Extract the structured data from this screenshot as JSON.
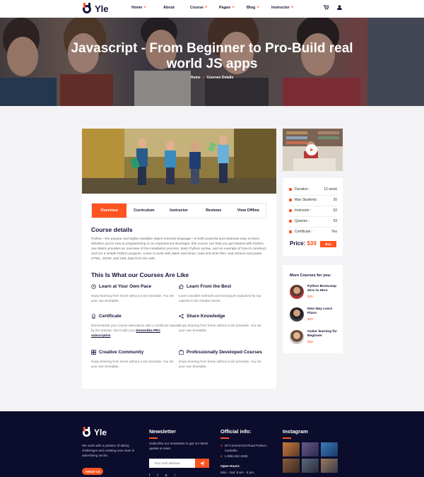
{
  "brand": {
    "name": "Yle",
    "accent": "#ff5421",
    "dark": "#15153a"
  },
  "nav": {
    "items": [
      {
        "label": "Home",
        "plus": "+"
      },
      {
        "label": "About",
        "plus": ""
      },
      {
        "label": "Course",
        "plus": "+"
      },
      {
        "label": "Pages",
        "plus": "+"
      },
      {
        "label": "Blog",
        "plus": "+"
      },
      {
        "label": "Instructor",
        "plus": "+"
      }
    ],
    "icons": [
      "cart-icon",
      "user-icon"
    ]
  },
  "hero": {
    "title": "Javascript - From Beginner to Pro-Build real world JS apps",
    "breadcrumb": {
      "home": "Home",
      "sep": "»",
      "current": "Courses Details"
    }
  },
  "tabs": [
    {
      "label": "Overview",
      "active": true
    },
    {
      "label": "Curriculum",
      "active": false
    },
    {
      "label": "Instructor",
      "active": false
    },
    {
      "label": "Reviews",
      "active": false
    },
    {
      "label": "View Offline",
      "active": false
    }
  ],
  "details": {
    "title": "Course details",
    "text": "Python—the popular and highly readable object-oriented language—is both powerful and relatively easy to learn. Whether you're new to programming or an experienced developer, this course can help you get started with Python. Joe Marini provides an overview of the installation process, basic Python syntax, and an example of how to construct and run a simple Python program. Learn to work with dates and times, read and write files, and retrieve and parse HTML, JSON, and XML data from the web."
  },
  "features": {
    "title": "This Is What our Courses Are Like",
    "items": [
      {
        "icon": "clock-icon",
        "title": "Learn at Your Own Pace",
        "text": "Enjoy learning from home without a set schedule. You set your own timetable.",
        "link": ""
      },
      {
        "icon": "thumbs-up-icon",
        "title": "Learn From the Best",
        "text": "Learn valuable methods and techniques explained by top experts in the creative sector.",
        "link": ""
      },
      {
        "icon": "certificate-icon",
        "title": "Certificate",
        "text": "Demonstrate your course attendance with a certificate signed by the teacher. Get it with your",
        "link": "Domestika PRO subscription"
      },
      {
        "icon": "share-icon",
        "title": "Share Knowledge",
        "text": "Enjoy learning from home without a set schedule. You set your own timetable.",
        "link": ""
      },
      {
        "icon": "community-icon",
        "title": "Creative Community",
        "text": "Enjoy learning from home without a set schedule. You set your own timetable.",
        "link": ""
      },
      {
        "icon": "briefcase-icon",
        "title": "Professionally Developed Courses",
        "text": "Enjoy learning from home without a set schedule. You set your own timetable.",
        "link": ""
      }
    ]
  },
  "info": {
    "rows": [
      {
        "label": "Duration :",
        "value": "12 week"
      },
      {
        "label": "Max Students :",
        "value": "20"
      },
      {
        "label": "Instructor :",
        "value": "02"
      },
      {
        "label": "Quizzes :",
        "value": "03"
      },
      {
        "label": "Certificate :",
        "value": "Yes"
      }
    ],
    "price_label": "Price:",
    "price": "$39",
    "buy": "Buy"
  },
  "more": {
    "title": "More Courses for you:",
    "items": [
      {
        "title": "Python Bootcamp Zero to Hero",
        "price": "$39"
      },
      {
        "title": "New Way Learn Piano",
        "price": "$39"
      },
      {
        "title": "Guitar learning for Beginner",
        "price": "$39"
      }
    ]
  },
  "footer": {
    "about": "We work with a passion of taking challenges and creating new ones in advertising sector.",
    "about_btn": "ABOUT US",
    "newsletter_title": "Newsletter",
    "newsletter_text": "Subscribe our newsletter to get our latest update & news",
    "email_placeholder": "Your mail address",
    "social": [
      "f",
      "t",
      "p",
      "i"
    ],
    "official_title": "Official info:",
    "address": "30 Commercial Road Fratton, Australia",
    "phone": "1-888-452-1505",
    "hours_title": "Open Hours:",
    "hours": "Mon - Sat: 8 am - 5 pm,",
    "instagram_title": "Instagram"
  }
}
